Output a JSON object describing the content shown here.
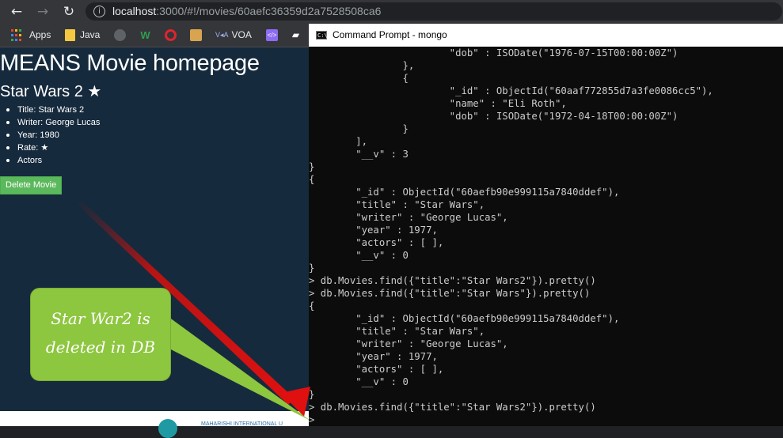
{
  "browser": {
    "back_icon": "←",
    "forward_icon": "→",
    "reload_icon": "↻",
    "info_icon": "i",
    "url_host": "localhost",
    "url_rest": ":3000/#!/movies/60aefc36359d2a7528508ca6",
    "bookmarks": [
      {
        "label": "Apps",
        "icon": "apps-grid-icon"
      },
      {
        "label": "Java",
        "icon": "folder-icon",
        "color": "#f5c842"
      },
      {
        "label": "",
        "icon": "github-icon",
        "color": "#e8eaed"
      },
      {
        "label": "",
        "icon": "w-icon",
        "color": "#2e9e4f"
      },
      {
        "label": "",
        "icon": "opera-icon",
        "color": "#e0242e"
      },
      {
        "label": "",
        "icon": "box-icon",
        "color": "#d8a450"
      },
      {
        "label": "VOA",
        "icon": "voa-icon",
        "color": "#3d6ad6"
      },
      {
        "label": "",
        "icon": "code-icon",
        "color": "#8c6cf2"
      },
      {
        "label": "",
        "icon": "cap-icon",
        "color": "#ffffff"
      }
    ]
  },
  "webpage": {
    "title": "MEANS Movie homepage",
    "movie_heading": "Star Wars 2 ★",
    "details": [
      "Title: Star Wars 2",
      "Writer: George Lucas",
      "Year: 1980",
      "Rate: ★",
      "Actors"
    ],
    "delete_button": "Delete Movie",
    "footer_text": "MAHARISHI INTERNATIONAL U"
  },
  "cmd": {
    "icon_text": "C:\\",
    "title": "Command Prompt - mongo",
    "lines": [
      "                        \"dob\" : ISODate(\"1976-07-15T00:00:00Z\")",
      "                },",
      "                {",
      "                        \"_id\" : ObjectId(\"60aaf772855d7a3fe0086cc5\"),",
      "                        \"name\" : \"Eli Roth\",",
      "                        \"dob\" : ISODate(\"1972-04-18T00:00:00Z\")",
      "                }",
      "        ],",
      "        \"__v\" : 3",
      "}",
      "{",
      "        \"_id\" : ObjectId(\"60aefb90e999115a7840ddef\"),",
      "        \"title\" : \"Star Wars\",",
      "        \"writer\" : \"George Lucas\",",
      "        \"year\" : 1977,",
      "        \"actors\" : [ ],",
      "        \"__v\" : 0",
      "}",
      "> db.Movies.find({\"title\":\"Star Wars2\"}).pretty()",
      "> db.Movies.find({\"title\":\"Star Wars\"}).pretty()",
      "{",
      "        \"_id\" : ObjectId(\"60aefb90e999115a7840ddef\"),",
      "        \"title\" : \"Star Wars\",",
      "        \"writer\" : \"George Lucas\",",
      "        \"year\" : 1977,",
      "        \"actors\" : [ ],",
      "        \"__v\" : 0",
      "}",
      "> db.Movies.find({\"title\":\"Star Wars2\"}).pretty()",
      ">"
    ]
  },
  "annotation": {
    "line1": "Star War2 is",
    "line2": "deleted in DB",
    "bubble_color": "#8dc63f",
    "arrow_color": "#cc1111"
  }
}
